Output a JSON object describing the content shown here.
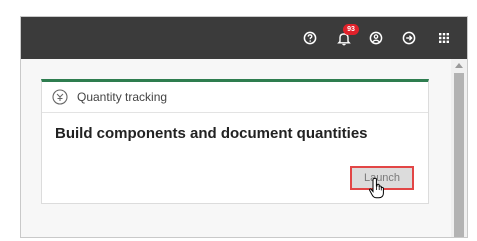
{
  "topbar": {
    "icons": [
      "help-icon",
      "bell-icon",
      "user-icon",
      "logout-icon",
      "apps-grid-icon"
    ],
    "notification_count": "93"
  },
  "card": {
    "header_title": "Quantity tracking",
    "header_icon": "quantity-tracking-icon",
    "heading": "Build components and document quantities",
    "launch_label": "Launch",
    "accent_color": "#2e7d4f",
    "highlight_color": "#e24646"
  }
}
